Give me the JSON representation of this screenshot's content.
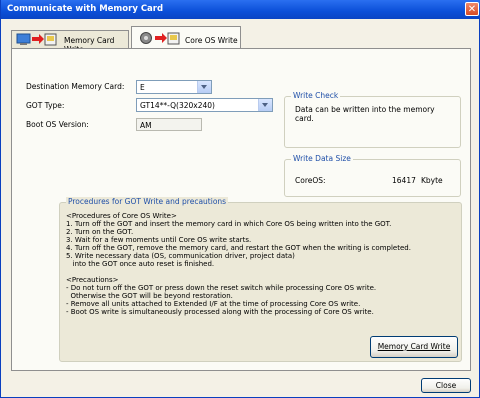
{
  "window": {
    "title": "Communicate with Memory Card",
    "close_glyph": "✕"
  },
  "tabs": [
    {
      "label": "Memory Card Write"
    },
    {
      "label": "Core OS Write"
    }
  ],
  "form": {
    "destination": {
      "label": "Destination Memory Card:",
      "value": "E"
    },
    "got_type": {
      "label": "GOT Type:",
      "value": "GT14**-Q(320x240)"
    },
    "boot_os": {
      "label": "Boot OS Version:",
      "value": "AM"
    }
  },
  "write_check": {
    "title": "Write Check",
    "message_line1": "Data can be written into the memory",
    "message_line2": "card."
  },
  "write_data_size": {
    "title": "Write Data Size",
    "label": "CoreOS:",
    "value": "16417",
    "unit": "Kbyte"
  },
  "procedures": {
    "title": "Procedures for GOT Write and precautions",
    "lines": [
      "<Procedures of Core OS Write>",
      "1. Turn off the GOT and insert the memory card in which Core OS being written into the GOT.",
      "2. Turn on the GOT.",
      "3. Wait for a few moments until Core OS write starts.",
      "4. Turn off the GOT, remove the memory card, and restart the GOT when the writing is completed.",
      "5. Write necessary data (OS, communication driver, project data)",
      "   into the GOT once auto reset is finished.",
      "",
      "<Precautions>",
      "- Do not turn off the GOT or press down the reset switch while processing Core OS write.",
      "  Otherwise the GOT will be beyond restoration.",
      "- Remove all units attached to Extended I/F at the time of processing Core OS write.",
      "- Boot OS write is simultaneously processed along with the processing of Core OS write."
    ]
  },
  "buttons": {
    "write": "Memory Card Write",
    "close": "Close"
  }
}
